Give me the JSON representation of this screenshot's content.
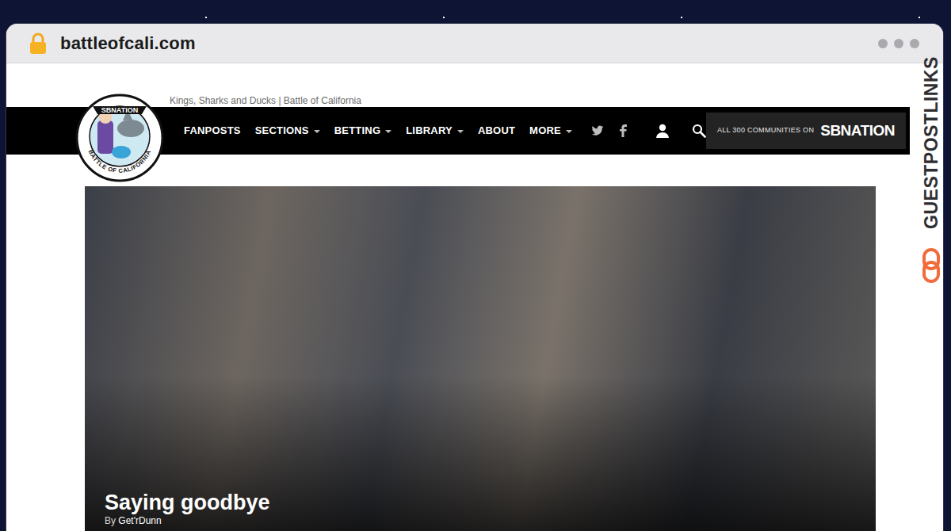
{
  "browser": {
    "url": "battleofcali.com"
  },
  "site": {
    "tagline": "Kings, Sharks and Ducks | Battle of California"
  },
  "logo": {
    "top": "SBNATION",
    "bottom": "BATTLE OF CALIFORNIA"
  },
  "nav": [
    {
      "label": "FANPOSTS",
      "dropdown": false
    },
    {
      "label": "SECTIONS",
      "dropdown": true
    },
    {
      "label": "BETTING",
      "dropdown": true
    },
    {
      "label": "LIBRARY",
      "dropdown": true
    },
    {
      "label": "ABOUT",
      "dropdown": false
    },
    {
      "label": "MORE",
      "dropdown": true
    }
  ],
  "network": {
    "prefix": "ALL 300 COMMUNITIES ON",
    "brand": "SBNATION"
  },
  "hero": {
    "title": "Saying goodbye",
    "byline_prefix": "By",
    "author": "Get'rDunn"
  },
  "watermark": {
    "text": "GUESTPOSTLINKS"
  }
}
